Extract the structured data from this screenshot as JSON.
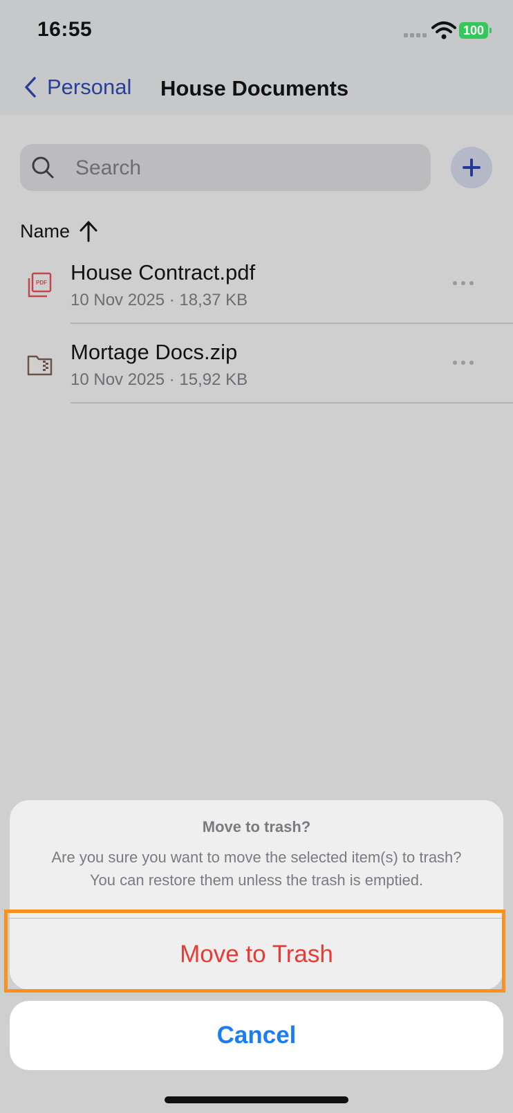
{
  "status_bar": {
    "time": "16:55",
    "battery": "100",
    "icons": [
      "cellular-signal-icon",
      "wifi-icon",
      "battery-icon"
    ]
  },
  "nav": {
    "back_label": "Personal",
    "title": "House Documents"
  },
  "search": {
    "placeholder": "Search",
    "value": ""
  },
  "sort": {
    "label": "Name",
    "direction": "ascending"
  },
  "files": [
    {
      "name": "House Contract.pdf",
      "meta": "10 Nov 2025 · 18,37 KB",
      "icon": "pdf-file-icon"
    },
    {
      "name": "Mortage Docs.zip",
      "meta": "10 Nov 2025 · 15,92 KB",
      "icon": "zip-folder-icon"
    }
  ],
  "dialog": {
    "title": "Move to trash?",
    "message": "Are you sure you want to move the selected item(s) to trash? You can restore them unless the trash is emptied.",
    "destructive_label": "Move to Trash",
    "cancel_label": "Cancel"
  },
  "colors": {
    "accent": "#2a3f9a",
    "destructive": "#ea3a32",
    "cancel_blue": "#1a7df5",
    "highlight": "#f4941e",
    "battery": "#34c759"
  }
}
